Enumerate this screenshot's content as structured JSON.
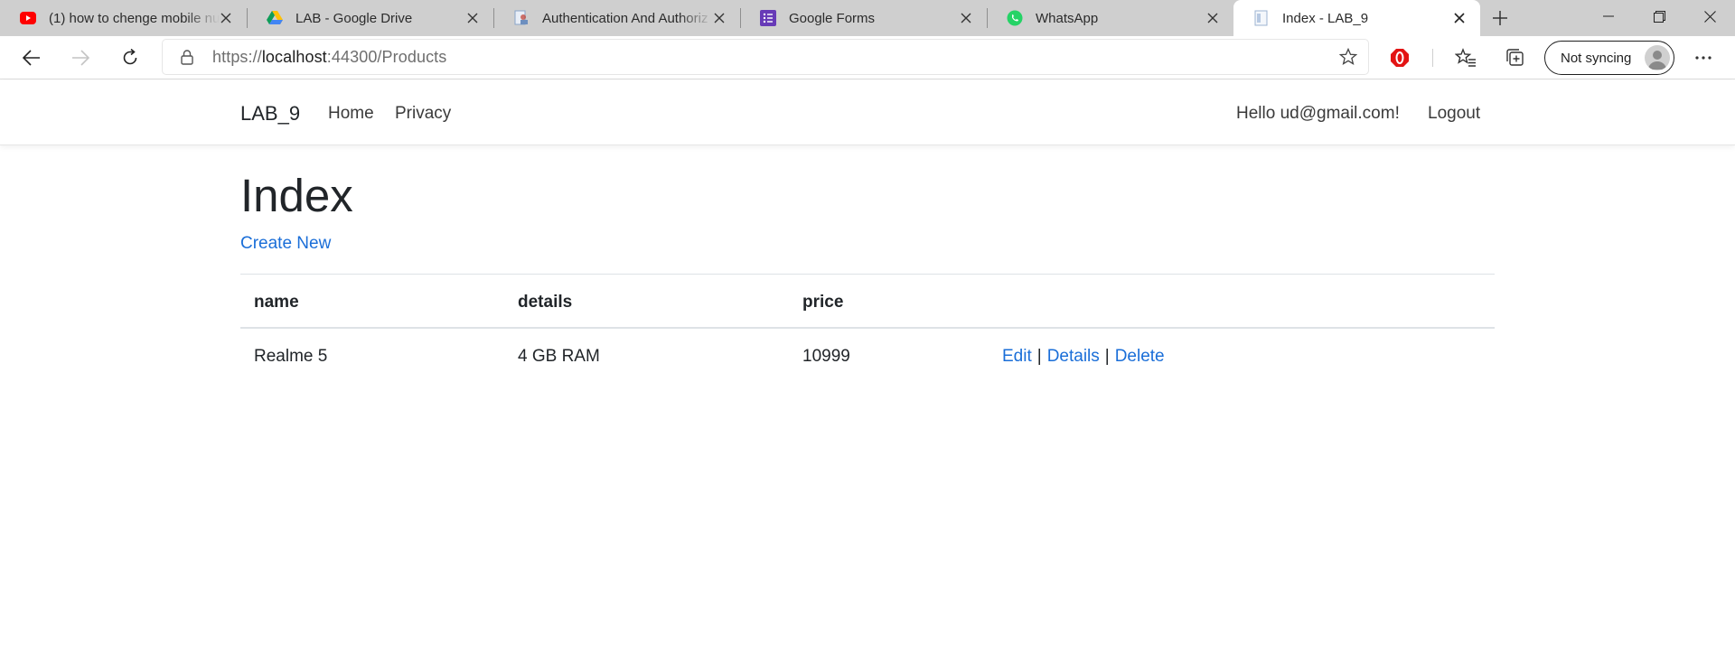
{
  "browser": {
    "tabs": [
      {
        "title": "(1) how to chenge mobile nu",
        "icon": "youtube-icon",
        "active": false
      },
      {
        "title": "LAB - Google Drive",
        "icon": "google-drive-icon",
        "active": false
      },
      {
        "title": "Authentication And Authoriz",
        "icon": "document-icon",
        "active": false
      },
      {
        "title": "Google Forms",
        "icon": "google-forms-icon",
        "active": false
      },
      {
        "title": "WhatsApp",
        "icon": "whatsapp-icon",
        "active": false
      },
      {
        "title": "Index - LAB_9",
        "icon": "page-icon",
        "active": true
      }
    ],
    "address": {
      "scheme": "https://",
      "host": "localhost",
      "rest": ":44300/Products"
    },
    "profile_label": "Not syncing"
  },
  "site": {
    "brand": "LAB_9",
    "nav": {
      "home": "Home",
      "privacy": "Privacy"
    },
    "greeting": "Hello ud@gmail.com!",
    "logout": "Logout"
  },
  "main": {
    "title": "Index",
    "create_new": "Create New",
    "table": {
      "headers": {
        "name": "name",
        "details": "details",
        "price": "price"
      },
      "rows": [
        {
          "name": "Realme 5",
          "details": "4 GB RAM",
          "price": "10999",
          "actions": {
            "edit": "Edit",
            "details": "Details",
            "delete": "Delete"
          },
          "separator": "|"
        }
      ]
    }
  },
  "colors": {
    "link": "#1a6ed8",
    "tabstrip": "#cfcfcf",
    "text": "#212529"
  }
}
